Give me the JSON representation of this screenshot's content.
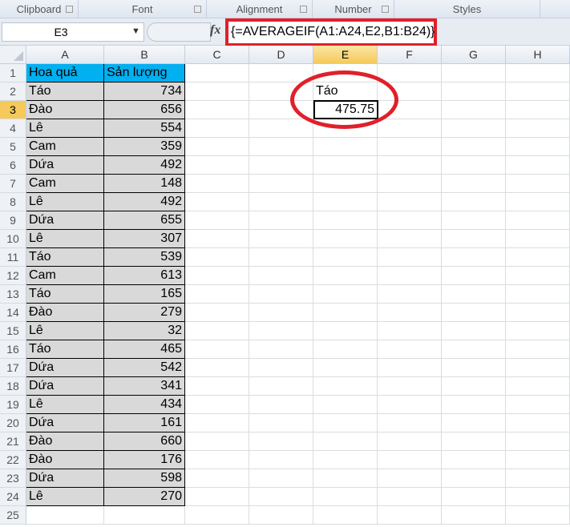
{
  "ribbon": {
    "groups": [
      "Clipboard",
      "Font",
      "Alignment",
      "Number",
      "Styles"
    ]
  },
  "formula_bar": {
    "name_box": "E3",
    "fx": "fx",
    "formula": "{=AVERAGEIF(A1:A24,E2,B1:B24)}"
  },
  "columns": [
    "A",
    "B",
    "C",
    "D",
    "E",
    "F",
    "G",
    "H"
  ],
  "selected_column": "E",
  "selected_row": 3,
  "rows": [
    "1",
    "2",
    "3",
    "4",
    "5",
    "6",
    "7",
    "8",
    "9",
    "10",
    "11",
    "12",
    "13",
    "14",
    "15",
    "16",
    "17",
    "18",
    "19",
    "20",
    "21",
    "22",
    "23",
    "24",
    "25"
  ],
  "table": {
    "headers": [
      "Hoa quả",
      "Sản lượng"
    ],
    "data": [
      [
        "Táo",
        "734"
      ],
      [
        "Đào",
        "656"
      ],
      [
        "Lê",
        "554"
      ],
      [
        "Cam",
        "359"
      ],
      [
        "Dứa",
        "492"
      ],
      [
        "Cam",
        "148"
      ],
      [
        "Lê",
        "492"
      ],
      [
        "Dứa",
        "655"
      ],
      [
        "Lê",
        "307"
      ],
      [
        "Táo",
        "539"
      ],
      [
        "Cam",
        "613"
      ],
      [
        "Táo",
        "165"
      ],
      [
        "Đào",
        "279"
      ],
      [
        "Lê",
        "32"
      ],
      [
        "Táo",
        "465"
      ],
      [
        "Dứa",
        "542"
      ],
      [
        "Dứa",
        "341"
      ],
      [
        "Lê",
        "434"
      ],
      [
        "Dứa",
        "161"
      ],
      [
        "Đào",
        "660"
      ],
      [
        "Đào",
        "176"
      ],
      [
        "Dứa",
        "598"
      ],
      [
        "Lê",
        "270"
      ]
    ]
  },
  "criteria": {
    "label": "Táo",
    "result": "475.75"
  },
  "colors": {
    "header_fill": "#00b0f0",
    "data_fill": "#d9d9d9",
    "highlight": "#e0202a"
  }
}
